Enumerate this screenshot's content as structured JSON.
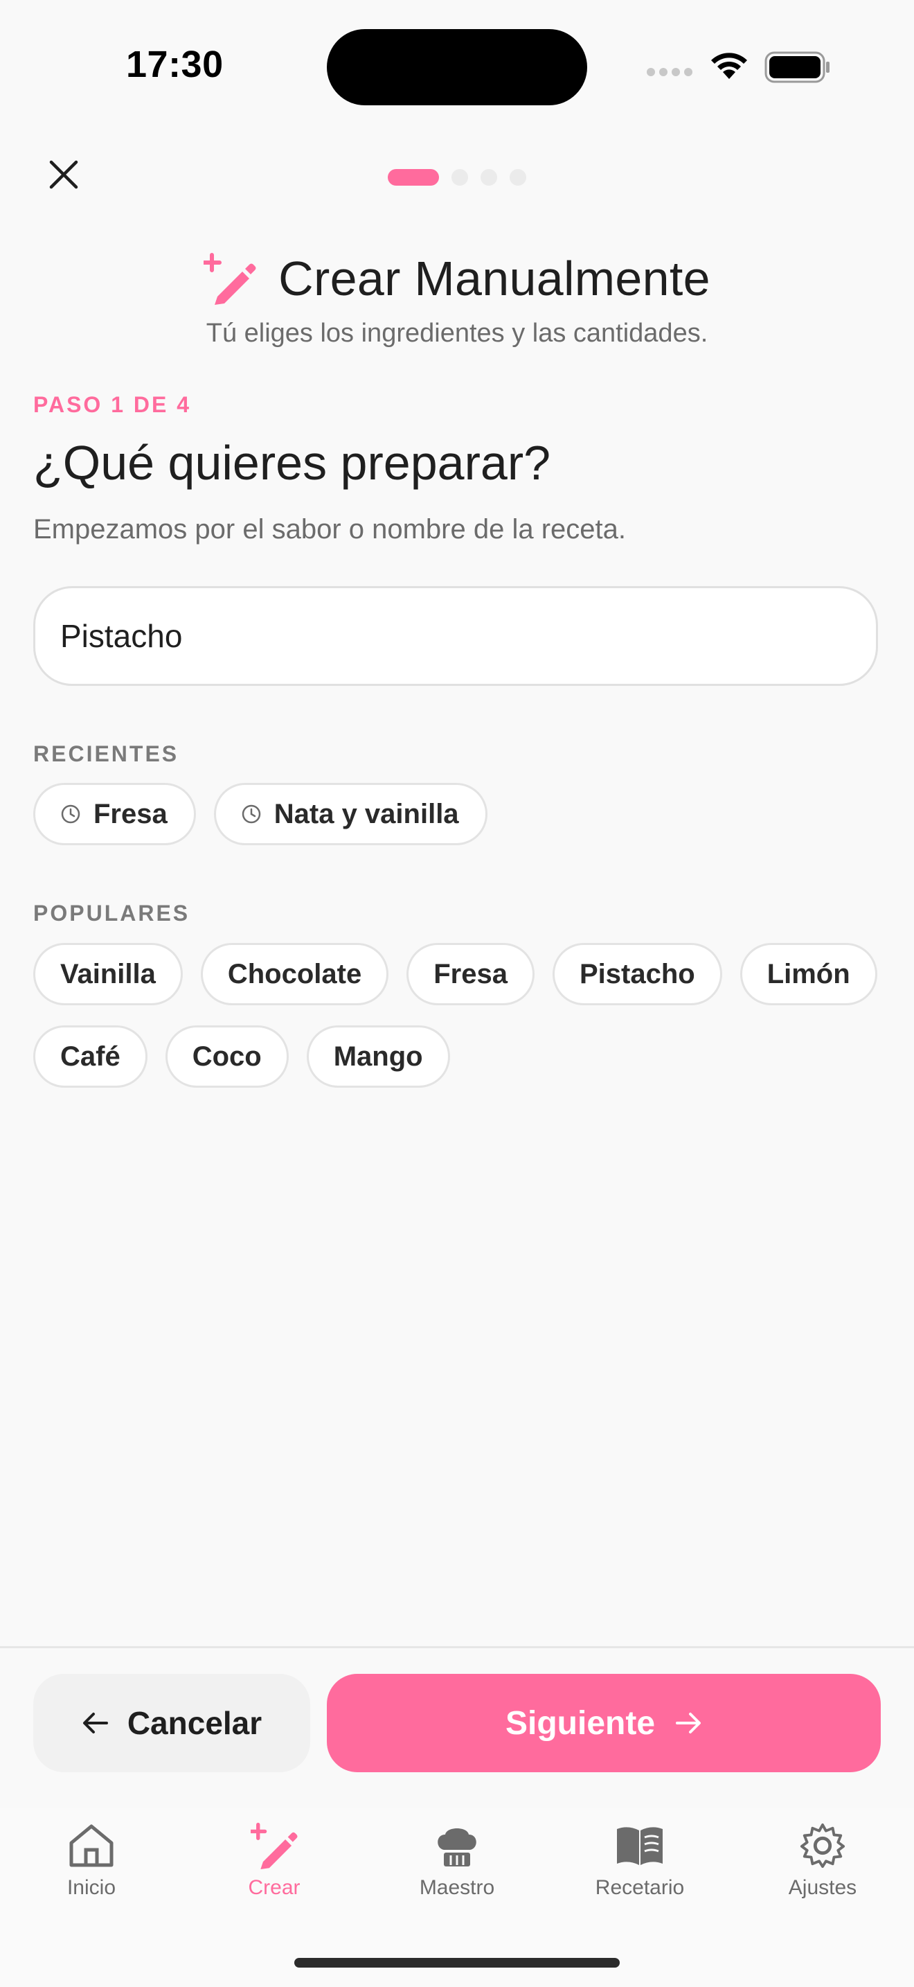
{
  "status_bar": {
    "time": "17:30"
  },
  "header": {
    "close_icon": "close-icon",
    "progress": {
      "current_step": 1,
      "total_steps": 4
    }
  },
  "title": {
    "icon": "magic-wand-icon",
    "text": "Crear Manualmente",
    "subtitle": "Tú eliges los ingredientes y las cantidades."
  },
  "step": {
    "label": "PASO 1 DE 4",
    "question": "¿Qué quieres preparar?",
    "hint": "Empezamos por el sabor o nombre de la receta."
  },
  "input": {
    "value": "Pistacho",
    "placeholder": ""
  },
  "recent": {
    "label": "RECIENTES",
    "items": [
      {
        "label": "Fresa",
        "icon": "clock-icon"
      },
      {
        "label": "Nata y vainilla",
        "icon": "clock-icon"
      }
    ]
  },
  "popular": {
    "label": "POPULARES",
    "items": [
      "Vainilla",
      "Chocolate",
      "Fresa",
      "Pistacho",
      "Limón",
      "Café",
      "Coco",
      "Mango"
    ]
  },
  "actions": {
    "cancel_label": "Cancelar",
    "next_label": "Siguiente"
  },
  "tabs": [
    {
      "label": "Inicio",
      "icon": "home-icon",
      "active": false
    },
    {
      "label": "Crear",
      "icon": "magic-wand-icon",
      "active": true
    },
    {
      "label": "Maestro",
      "icon": "chef-hat-icon",
      "active": false
    },
    {
      "label": "Recetario",
      "icon": "book-icon",
      "active": false
    },
    {
      "label": "Ajustes",
      "icon": "gear-icon",
      "active": false
    }
  ],
  "colors": {
    "accent": "#ff6b9d",
    "background": "#f9f9f9",
    "text": "#1f1f1f",
    "muted": "#6b6b6b"
  }
}
